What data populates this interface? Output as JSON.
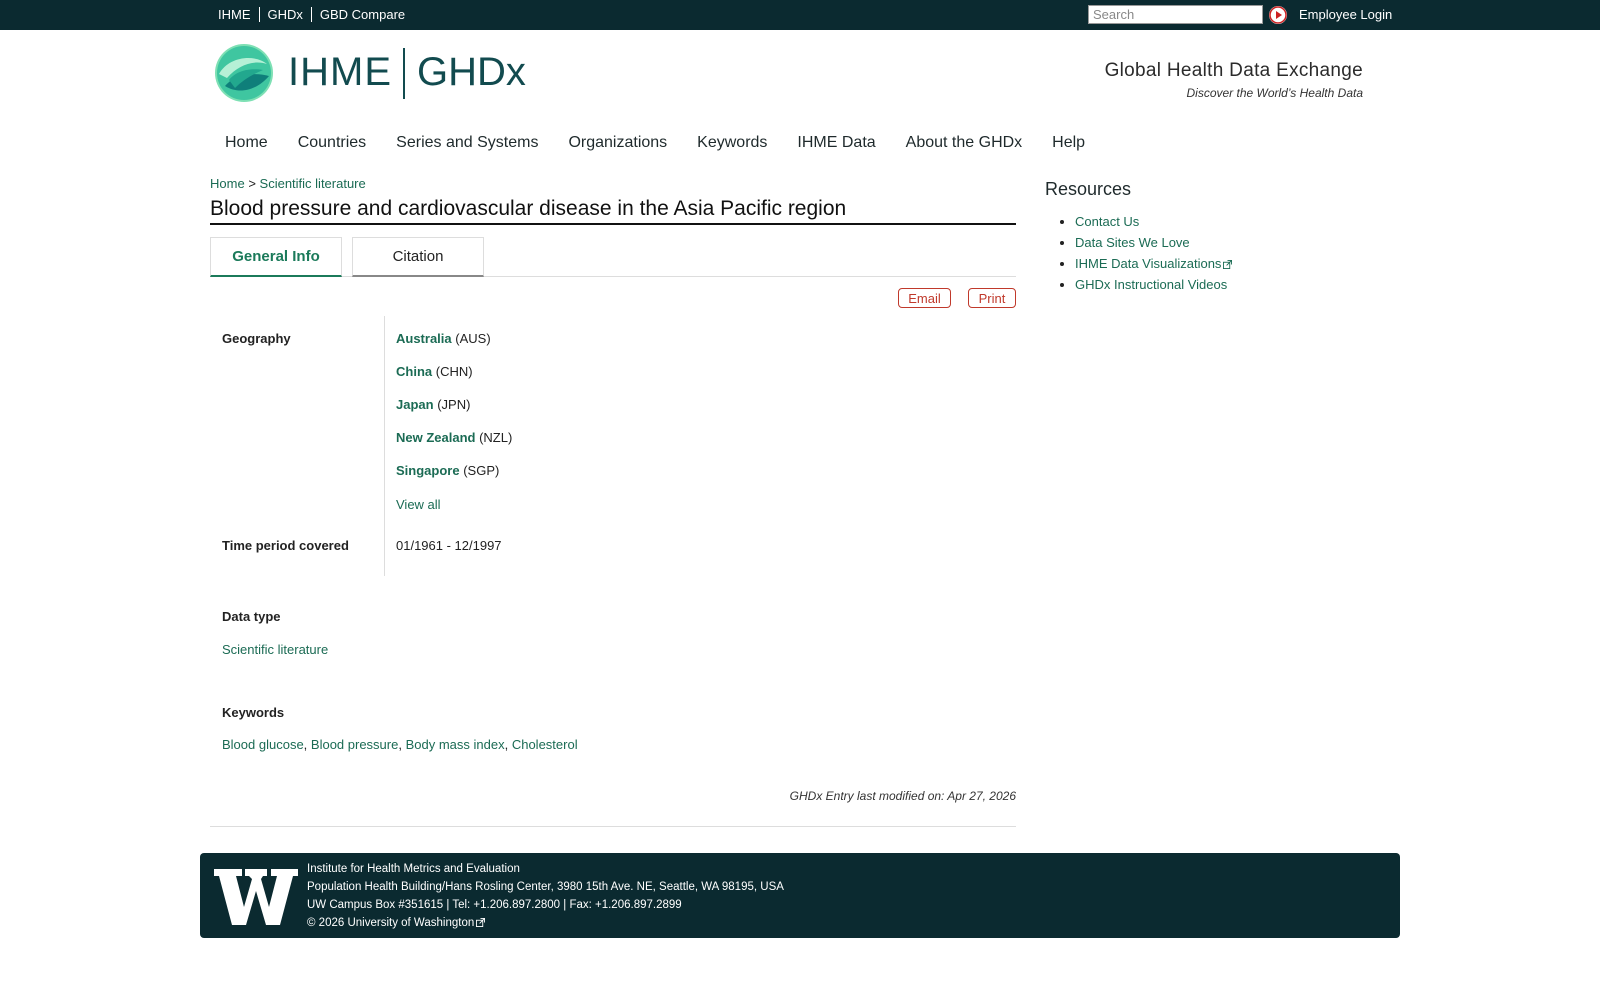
{
  "topbar": {
    "links": [
      "IHME",
      "GHDx",
      "GBD Compare"
    ],
    "search_placeholder": "Search",
    "login_label": "Employee Login"
  },
  "header": {
    "logo_ihme": "IHME",
    "logo_ghdx": "GHDx",
    "tagline_title": "Global Health Data Exchange",
    "tagline_sub": "Discover the World’s Health Data"
  },
  "nav": [
    "Home",
    "Countries",
    "Series and Systems",
    "Organizations",
    "Keywords",
    "IHME Data",
    "About the GHDx",
    "Help"
  ],
  "breadcrumb": {
    "home": "Home",
    "sep": ">",
    "current": "Scientific literature"
  },
  "page": {
    "title": "Blood pressure and cardiovascular disease in the Asia Pacific region",
    "tabs": [
      "General Info",
      "Citation"
    ],
    "email_label": "Email",
    "print_label": "Print"
  },
  "info": {
    "geography_label": "Geography",
    "countries": [
      {
        "name": "Australia",
        "code": "(AUS)"
      },
      {
        "name": "China",
        "code": "(CHN)"
      },
      {
        "name": "Japan",
        "code": "(JPN)"
      },
      {
        "name": "New Zealand",
        "code": "(NZL)"
      },
      {
        "name": "Singapore",
        "code": "(SGP)"
      }
    ],
    "view_all": "View all",
    "time_label": "Time period covered",
    "time_value": "01/1961 - 12/1997",
    "datatype_label": "Data type",
    "datatype_value": "Scientific literature",
    "keywords_label": "Keywords",
    "keywords": [
      "Blood glucose",
      "Blood pressure",
      "Body mass index",
      "Cholesterol"
    ],
    "modified": "GHDx Entry last modified on: Apr 27, 2026"
  },
  "sidebar": {
    "title": "Resources",
    "links": [
      "Contact Us",
      "Data Sites We Love",
      "IHME Data Visualizations",
      "GHDx Instructional Videos"
    ]
  },
  "footer": {
    "line1": "Institute for Health Metrics and Evaluation",
    "line2": "Population Health Building/Hans Rosling Center, 3980 15th Ave. NE, Seattle, WA 98195, USA",
    "line3": "UW Campus Box #351615 | Tel: +1.206.897.2800 | Fax: +1.206.897.2899",
    "copyright": "© 2026",
    "uw_link": "University of Washington"
  },
  "colors": {
    "topbar_bg": "#0b2a30",
    "link_green": "#1b6b54",
    "tab_active": "#1b7a5a",
    "button_red": "#c0392b"
  }
}
